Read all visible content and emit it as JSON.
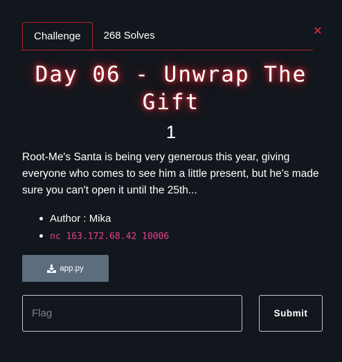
{
  "tabs": [
    {
      "label": "Challenge"
    },
    {
      "label": "268 Solves"
    }
  ],
  "close": {
    "glyph": "✕"
  },
  "challenge": {
    "title": "Day 06 - Unwrap The Gift",
    "value": "1",
    "description": "Root-Me's Santa is being very generous this year, giving everyone who comes to see him a little present, but he's made sure you can't open it until the 25th...",
    "author": "Author : Mika",
    "connection": "nc 163.172.68.42 10006",
    "file": {
      "name": "app.py",
      "icon": "download-icon"
    }
  },
  "form": {
    "flag_placeholder": "Flag",
    "flag_value": "",
    "submit_label": "Submit"
  },
  "colors": {
    "background": "#12171d",
    "accent": "#b2242d",
    "close": "#e0303c",
    "file_button": "#5c6d7e",
    "code": "#e83e8c"
  }
}
